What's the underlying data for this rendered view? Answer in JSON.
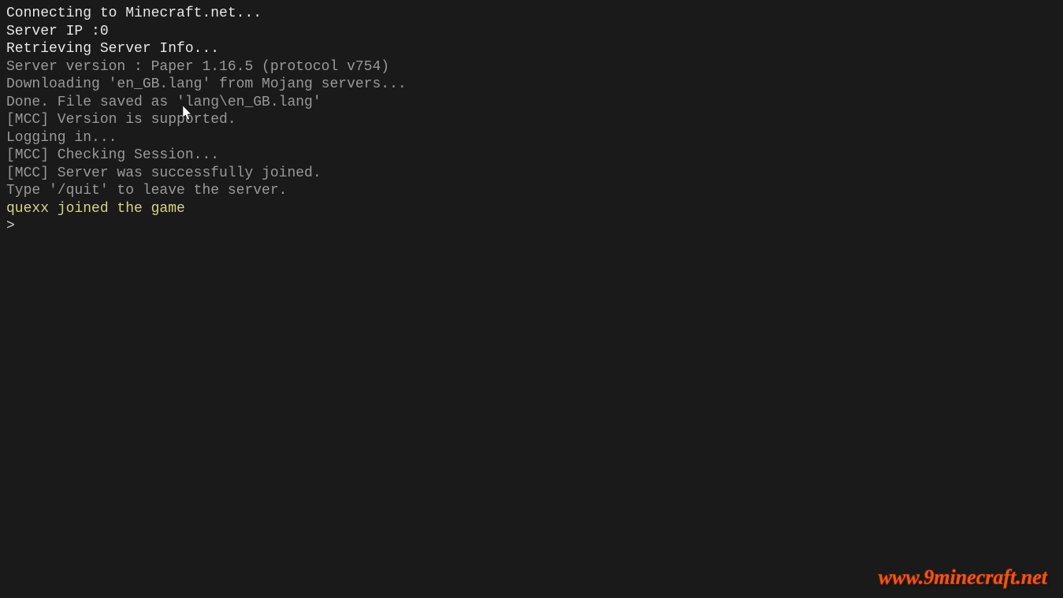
{
  "console": {
    "lines": [
      {
        "text": "Connecting to Minecraft.net...",
        "style": "white"
      },
      {
        "text": "Server IP :0",
        "style": "white"
      },
      {
        "text": "Retrieving Server Info...",
        "style": "white"
      },
      {
        "text": "Server version : Paper 1.16.5 (protocol v754)",
        "style": "gray"
      },
      {
        "text": "Downloading 'en_GB.lang' from Mojang servers...",
        "style": "gray"
      },
      {
        "text": "Done. File saved as 'lang\\en_GB.lang'",
        "style": "gray"
      },
      {
        "text": "[MCC] Version is supported.",
        "style": "gray"
      },
      {
        "text": "Logging in...",
        "style": "gray"
      },
      {
        "text": "[MCC] Checking Session...",
        "style": "gray"
      },
      {
        "text": "[MCC] Server was successfully joined.",
        "style": "gray"
      },
      {
        "text": "Type '/quit' to leave the server.",
        "style": "gray"
      },
      {
        "text": "quexx joined the game",
        "style": "yellow"
      }
    ],
    "prompt_symbol": ">",
    "prompt_value": ""
  },
  "watermark": {
    "text": "www.9minecraft.net"
  }
}
